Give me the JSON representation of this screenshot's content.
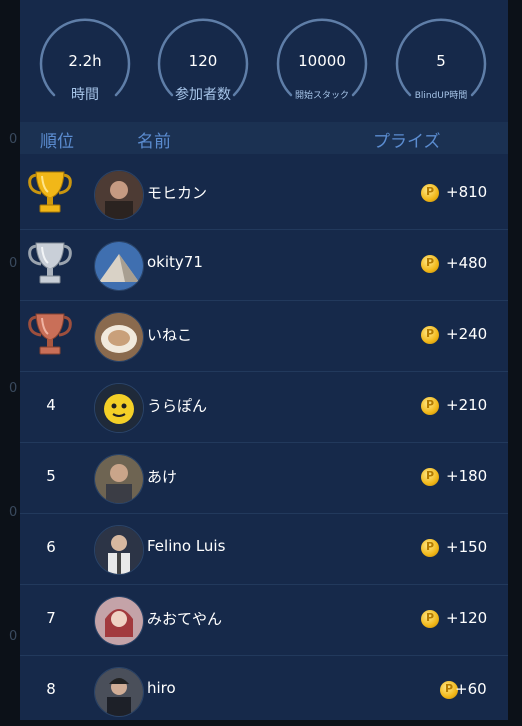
{
  "side_marks": [
    "0",
    "0",
    "0",
    "0",
    "0"
  ],
  "stats": [
    {
      "value": "2.2h",
      "label": "時間",
      "icon": "gauge-ring"
    },
    {
      "value": "120",
      "label": "参加者数",
      "icon": "gauge-ring"
    },
    {
      "value": "10000",
      "label": "開始スタック",
      "icon": "gauge-ring"
    },
    {
      "value": "5",
      "label": "BlindUP時間",
      "icon": "gauge-ring"
    }
  ],
  "header": {
    "rank": "順位",
    "name": "名前",
    "prize": "プライズ"
  },
  "coin_symbol": "P",
  "colors": {
    "panel": "#16294a",
    "header": "#1b3152",
    "header_text": "#5b8cd0",
    "label_text": "#a6c4e8",
    "gold": "#f1b718",
    "silver": "#c9cfd8",
    "bronze": "#c96f58"
  },
  "rows": [
    {
      "rank": "1",
      "trophy": "gold-trophy-icon",
      "name": "モヒカン",
      "prize": "+810",
      "avatar": "avatar-photo"
    },
    {
      "rank": "2",
      "trophy": "silver-trophy-icon",
      "name": "okity71",
      "prize": "+480",
      "avatar": "avatar-photo"
    },
    {
      "rank": "3",
      "trophy": "bronze-trophy-icon",
      "name": "いねこ",
      "prize": "+240",
      "avatar": "avatar-photo"
    },
    {
      "rank": "4",
      "name": "うらぽん",
      "prize": "+210",
      "avatar": "avatar-photo"
    },
    {
      "rank": "5",
      "name": "あけ",
      "prize": "+180",
      "avatar": "avatar-photo"
    },
    {
      "rank": "6",
      "name": "Felino Luis",
      "prize": "+150",
      "avatar": "avatar-photo"
    },
    {
      "rank": "7",
      "name": "みおてやん",
      "prize": "+120",
      "avatar": "avatar-photo"
    },
    {
      "rank": "8",
      "name": "hiro",
      "prize": "+60",
      "avatar": "avatar-photo"
    }
  ]
}
